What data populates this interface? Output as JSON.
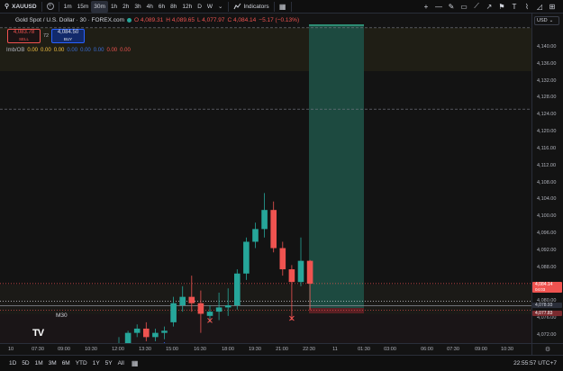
{
  "toolbar": {
    "symbol": "XAUUSD",
    "add_icon": "plus-circle-icon",
    "timeframes": [
      "1m",
      "15m",
      "30m",
      "1h",
      "2h",
      "3h",
      "4h",
      "6h",
      "8h",
      "12h",
      "D",
      "W"
    ],
    "active_timeframe": "30m",
    "indicators_label": "Indicators",
    "drawing_tools": [
      "crosshair-icon",
      "horizontal-line-icon",
      "brush-icon",
      "rectangle-icon",
      "trend-line-icon",
      "measure-icon",
      "flag-icon",
      "text-icon",
      "path-icon",
      "forecast-icon",
      "price-range-icon"
    ]
  },
  "legend": {
    "title": "Gold Spot / U.S. Dollar · 30 · FOREX.com",
    "ohlc": [
      "O 4,089.31",
      "H 4,089.65",
      "L 4,077.97",
      "C 4,084.14",
      "−5.17 (−0.13%)"
    ]
  },
  "order_buttons": {
    "sell_price": "4,083.78",
    "sell_label": "SELL",
    "spread": "72",
    "buy_price": "4,084.50",
    "buy_label": "BUY"
  },
  "indicator": {
    "label": "Imb/OB",
    "values": [
      {
        "text": "0.00",
        "color": "#f5c242"
      },
      {
        "text": "0.00",
        "color": "#f5c242"
      },
      {
        "text": "0.00",
        "color": "#f5c242"
      },
      {
        "text": "0.00",
        "color": "#3b6fd8"
      },
      {
        "text": "0.00",
        "color": "#3b6fd8"
      },
      {
        "text": "0.00",
        "color": "#3b6fd8"
      },
      {
        "text": "0.00",
        "color": "#ef5350"
      },
      {
        "text": "0.00",
        "color": "#ef5350"
      }
    ]
  },
  "chart_overlay": {
    "m30_label": "M30",
    "logo": "TV"
  },
  "price_axis": {
    "currency": "USD",
    "labels": [
      "4,140.00",
      "4,136.00",
      "4,132.00",
      "4,128.00",
      "4,124.00",
      "4,120.00",
      "4,116.00",
      "4,112.00",
      "4,108.00",
      "4,104.00",
      "4,100.00",
      "4,096.00",
      "4,092.00",
      "4,088.00",
      "4,080.00",
      "4,076.00",
      "4,072.00"
    ],
    "tags": [
      {
        "text": "4,084.14",
        "sub": "04:03",
        "kind": "red"
      },
      {
        "text": "4,078.93",
        "sub": "",
        "kind": "dark"
      },
      {
        "text": "4,077.83",
        "sub": "",
        "kind": "darkred"
      }
    ]
  },
  "chart_data": {
    "type": "candlestick",
    "price_range": [
      4069,
      4145
    ],
    "candles": [
      {
        "time": "12:00",
        "o": 4069.0,
        "h": 4071.5,
        "l": 4066.5,
        "c": 4070.0
      },
      {
        "time": "12:30",
        "o": 4069.0,
        "h": 4073.0,
        "l": 4067.0,
        "c": 4072.5
      },
      {
        "time": "13:00",
        "o": 4072.5,
        "h": 4074.5,
        "l": 4071.5,
        "c": 4073.5
      },
      {
        "time": "13:30",
        "o": 4073.5,
        "h": 4075.0,
        "l": 4070.5,
        "c": 4071.5
      },
      {
        "time": "14:00",
        "o": 4071.5,
        "h": 4073.5,
        "l": 4070.5,
        "c": 4072.5
      },
      {
        "time": "14:30",
        "o": 4072.5,
        "h": 4074.0,
        "l": 4071.0,
        "c": 4073.0
      },
      {
        "time": "15:00",
        "o": 4075.0,
        "h": 4081.0,
        "l": 4074.0,
        "c": 4079.5
      },
      {
        "time": "15:30",
        "o": 4079.0,
        "h": 4083.5,
        "l": 4077.5,
        "c": 4081.0
      },
      {
        "time": "16:00",
        "o": 4081.0,
        "h": 4086.0,
        "l": 4077.5,
        "c": 4079.5
      },
      {
        "time": "16:30",
        "o": 4079.5,
        "h": 4082.5,
        "l": 4072.5,
        "c": 4077.0
      },
      {
        "time": "17:00",
        "o": 4076.5,
        "h": 4079.0,
        "l": 4075.0,
        "c": 4077.5
      },
      {
        "time": "17:30",
        "o": 4077.5,
        "h": 4082.0,
        "l": 4075.5,
        "c": 4078.5
      },
      {
        "time": "18:00",
        "o": 4078.5,
        "h": 4083.0,
        "l": 4076.5,
        "c": 4079.0
      },
      {
        "time": "18:30",
        "o": 4079.0,
        "h": 4087.5,
        "l": 4078.0,
        "c": 4086.5
      },
      {
        "time": "19:00",
        "o": 4086.5,
        "h": 4095.0,
        "l": 4085.0,
        "c": 4094.0
      },
      {
        "time": "19:30",
        "o": 4094.0,
        "h": 4098.5,
        "l": 4092.5,
        "c": 4097.0
      },
      {
        "time": "20:00",
        "o": 4097.0,
        "h": 4105.5,
        "l": 4095.0,
        "c": 4101.5
      },
      {
        "time": "20:30",
        "o": 4101.5,
        "h": 4103.5,
        "l": 4091.5,
        "c": 4092.5
      },
      {
        "time": "21:00",
        "o": 4092.5,
        "h": 4094.0,
        "l": 4086.0,
        "c": 4087.5
      },
      {
        "time": "21:30",
        "o": 4087.5,
        "h": 4088.5,
        "l": 4075.5,
        "c": 4084.5
      },
      {
        "time": "22:00",
        "o": 4084.5,
        "h": 4095.0,
        "l": 4083.5,
        "c": 4089.5
      },
      {
        "time": "22:30",
        "o": 4089.5,
        "h": 4089.7,
        "l": 4077.9,
        "c": 4084.1
      }
    ],
    "time_axis": [
      "10",
      "07:30",
      "09:00",
      "10:30",
      "12:00",
      "13:30",
      "15:00",
      "16:30",
      "18:00",
      "19:30",
      "21:00",
      "22:30",
      "11",
      "01:30",
      "03:00",
      "06:00",
      "07:30",
      "09:00",
      "10:30"
    ],
    "levels": [
      {
        "price": 4084.14,
        "style": "dotted",
        "color": "#ef5350"
      },
      {
        "price": 4080.0,
        "style": "dotted",
        "color": "#d1d4dc"
      },
      {
        "price": 4078.93,
        "style": "solid",
        "color": "#8a8d97"
      },
      {
        "price": 4077.83,
        "style": "dotted",
        "color": "#ef5350"
      },
      {
        "price": 4125.3,
        "style": "dashed",
        "color": "#787b86"
      },
      {
        "price": 4144.5,
        "style": "dashed",
        "color": "#787b86"
      }
    ],
    "markers": [
      {
        "time": "17:00",
        "kind": "cross",
        "color": "#ef5350"
      },
      {
        "time": "21:30",
        "kind": "cross",
        "color": "#ef5350"
      },
      {
        "time": "14:30",
        "kind": "arrow-up",
        "color": "#2962ff"
      }
    ],
    "colors": {
      "up": "#26a69a",
      "down": "#ef5350"
    }
  },
  "bottombar": {
    "ranges": [
      "1D",
      "5D",
      "1M",
      "3M",
      "6M",
      "YTD",
      "1Y",
      "5Y",
      "All"
    ],
    "calendar_icon": "calendar-icon",
    "clock": "22:55:57 UTC+7"
  }
}
